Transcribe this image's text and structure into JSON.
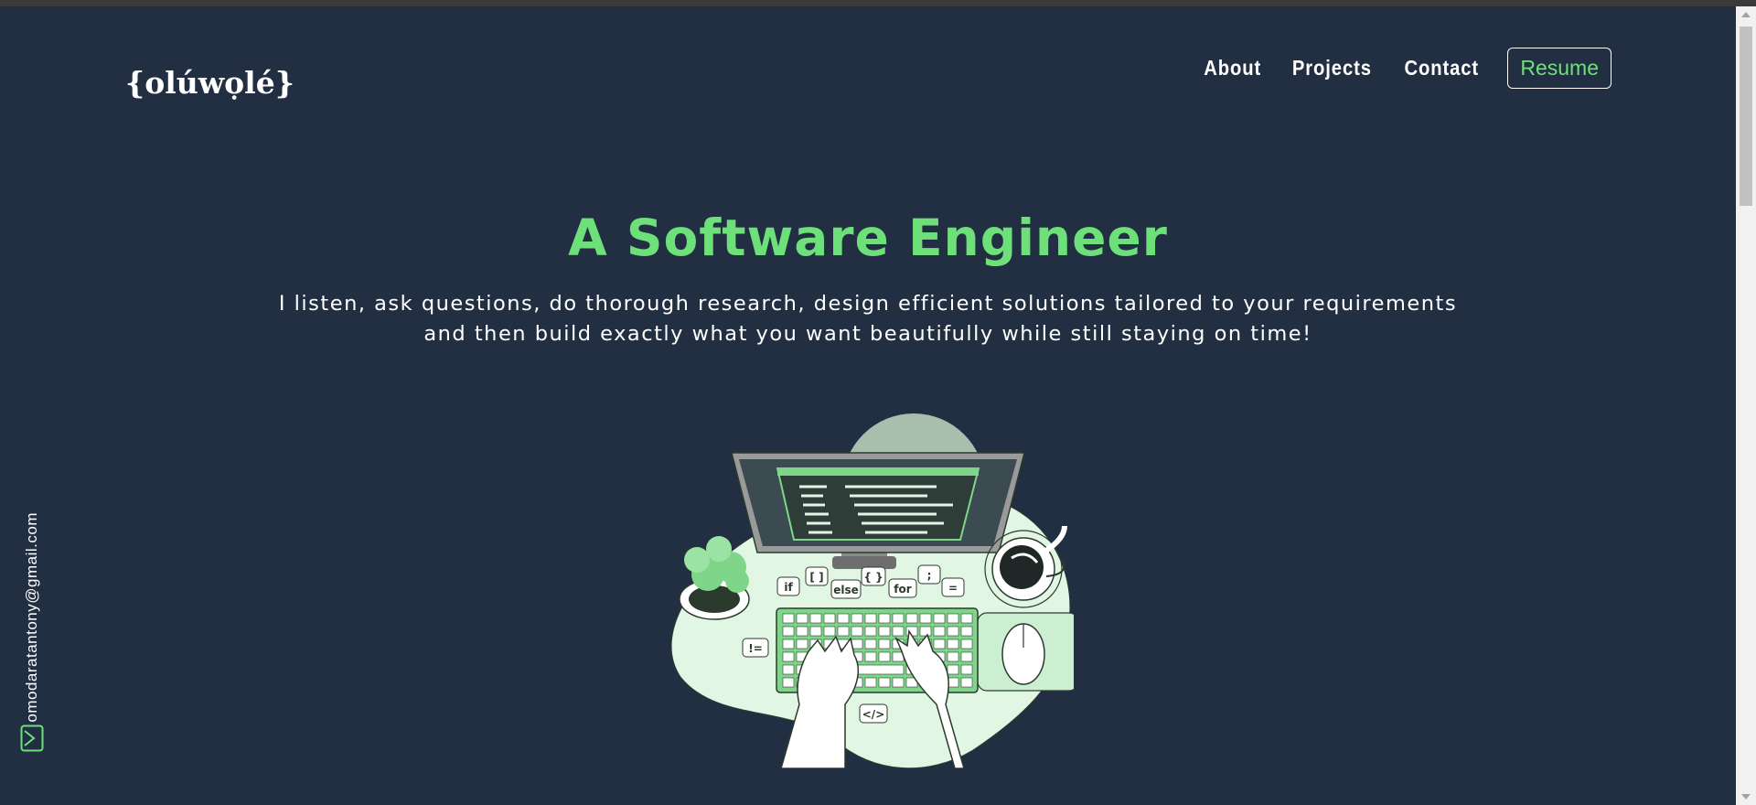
{
  "header": {
    "logo": "{olúwọlé}",
    "nav": [
      {
        "label": "About"
      },
      {
        "label": "Projects"
      },
      {
        "label": "Contact"
      }
    ],
    "resume_label": "Resume"
  },
  "hero": {
    "title": "A Software Engineer",
    "subtitle_line1": "I listen, ask questions, do thorough research, design efficient solutions tailored to your requirements",
    "subtitle_line2": "and then build exactly what you want beautifully while still staying on time!"
  },
  "sidebar": {
    "email": "omodaratantony@gmail.com",
    "icon": "mail-icon"
  },
  "illustration": {
    "code_bubbles": [
      "if",
      "[ ]",
      "else",
      "{ }",
      "for",
      ";",
      "=",
      "!=",
      "</>"
    ]
  },
  "colors": {
    "background": "#222f42",
    "accent": "#6ee07a",
    "text": "#ffffff"
  }
}
